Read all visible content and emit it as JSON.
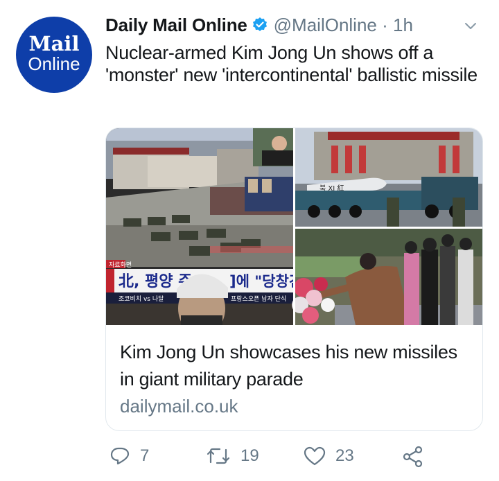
{
  "avatar": {
    "brand": "Mail",
    "sub": "Online"
  },
  "header": {
    "name": "Daily Mail Online",
    "handle": "@MailOnline · 1h"
  },
  "tweet_text": "Nuclear-armed Kim Jong Un shows off a 'monster' new 'intercontinental' ballistic missile",
  "card": {
    "title": "Kim Jong Un showcases his new missiles in giant military parade",
    "domain": "dailymail.co.uk",
    "tv_caption_top": "자료화면",
    "tv_caption_main": "北, 평양 주",
    "tv_caption_right": "]에 \"당창건",
    "tv_ticker": "조코비치 vs 나달",
    "tv_ticker_right": "프랑스오픈 남자 단식",
    "missile_label": "북 XI 紅"
  },
  "actions": {
    "reply_count": "7",
    "retweet_count": "19",
    "like_count": "23"
  },
  "colors": {
    "brand_blue": "#0e3ea9",
    "verified_blue": "#1da1f2",
    "muted": "#657786"
  }
}
